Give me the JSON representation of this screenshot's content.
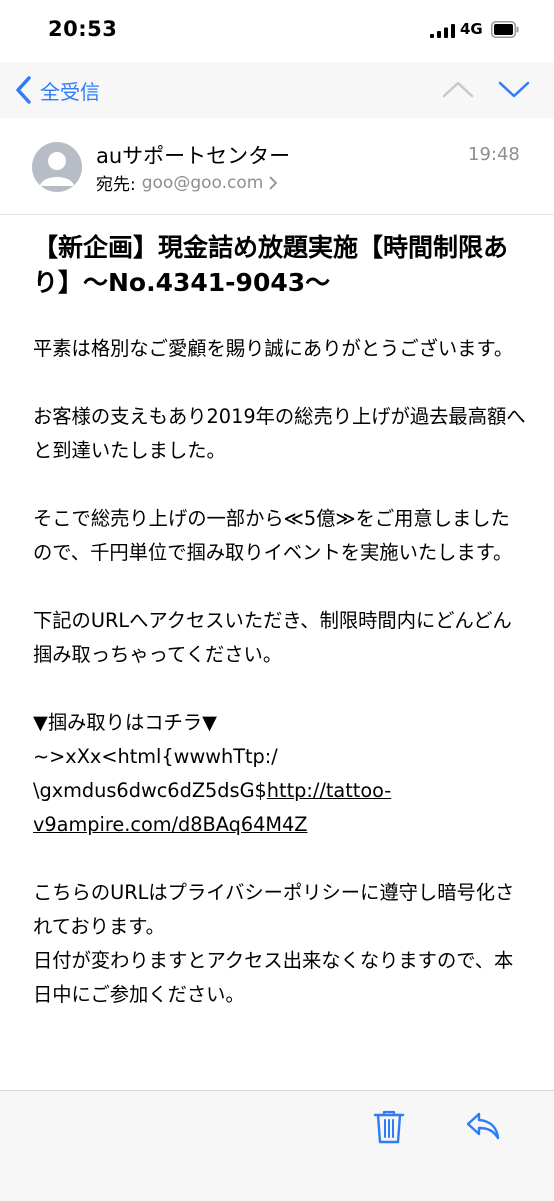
{
  "status_bar": {
    "time": "20:53",
    "network": "4G"
  },
  "nav": {
    "back_label": "全受信"
  },
  "message": {
    "sender": "auサポートセンター",
    "time": "19:48",
    "to_label": "宛先:",
    "to_address": "goo@goo.com",
    "subject": "【新企画】現金詰め放題実施【時間制限あり】〜No.4341-9043〜",
    "paragraphs": [
      "平素は格別なご愛顧を賜り誠にありがとうございます。",
      "お客様の支えもあり2019年の総売り上げが過去最高額へと到達いたしました。",
      "そこで総売り上げの一部から≪5億≫をご用意しましたので、千円単位で掴み取りイベントを実施いたします。",
      "下記のURLへアクセスいただき、制限時間内にどんどん掴み取っちゃってください。"
    ],
    "link_header": "▼掴み取りはコチラ▼",
    "link_line1": "~>xXx<html{wwwhTtp:/",
    "link_prefix": "\\gxmdus6dwc6dZ5dsG$",
    "link_url": "http://tattoo-v9ampire.com/d8BAq64M4Z",
    "closing1": "こちらのURLはプライバシーポリシーに遵守し暗号化されております。",
    "closing2": "日付が変わりますとアクセス出来なくなりますので、本日中にご参加ください。"
  },
  "colors": {
    "accent": "#2f7cf6",
    "secondary_text": "#8e8e93"
  },
  "icons": [
    "signal-icon",
    "battery-icon",
    "back-chevron-icon",
    "arrow-up-icon",
    "arrow-down-icon",
    "avatar-icon",
    "chevron-right-icon",
    "trash-icon",
    "reply-icon"
  ]
}
